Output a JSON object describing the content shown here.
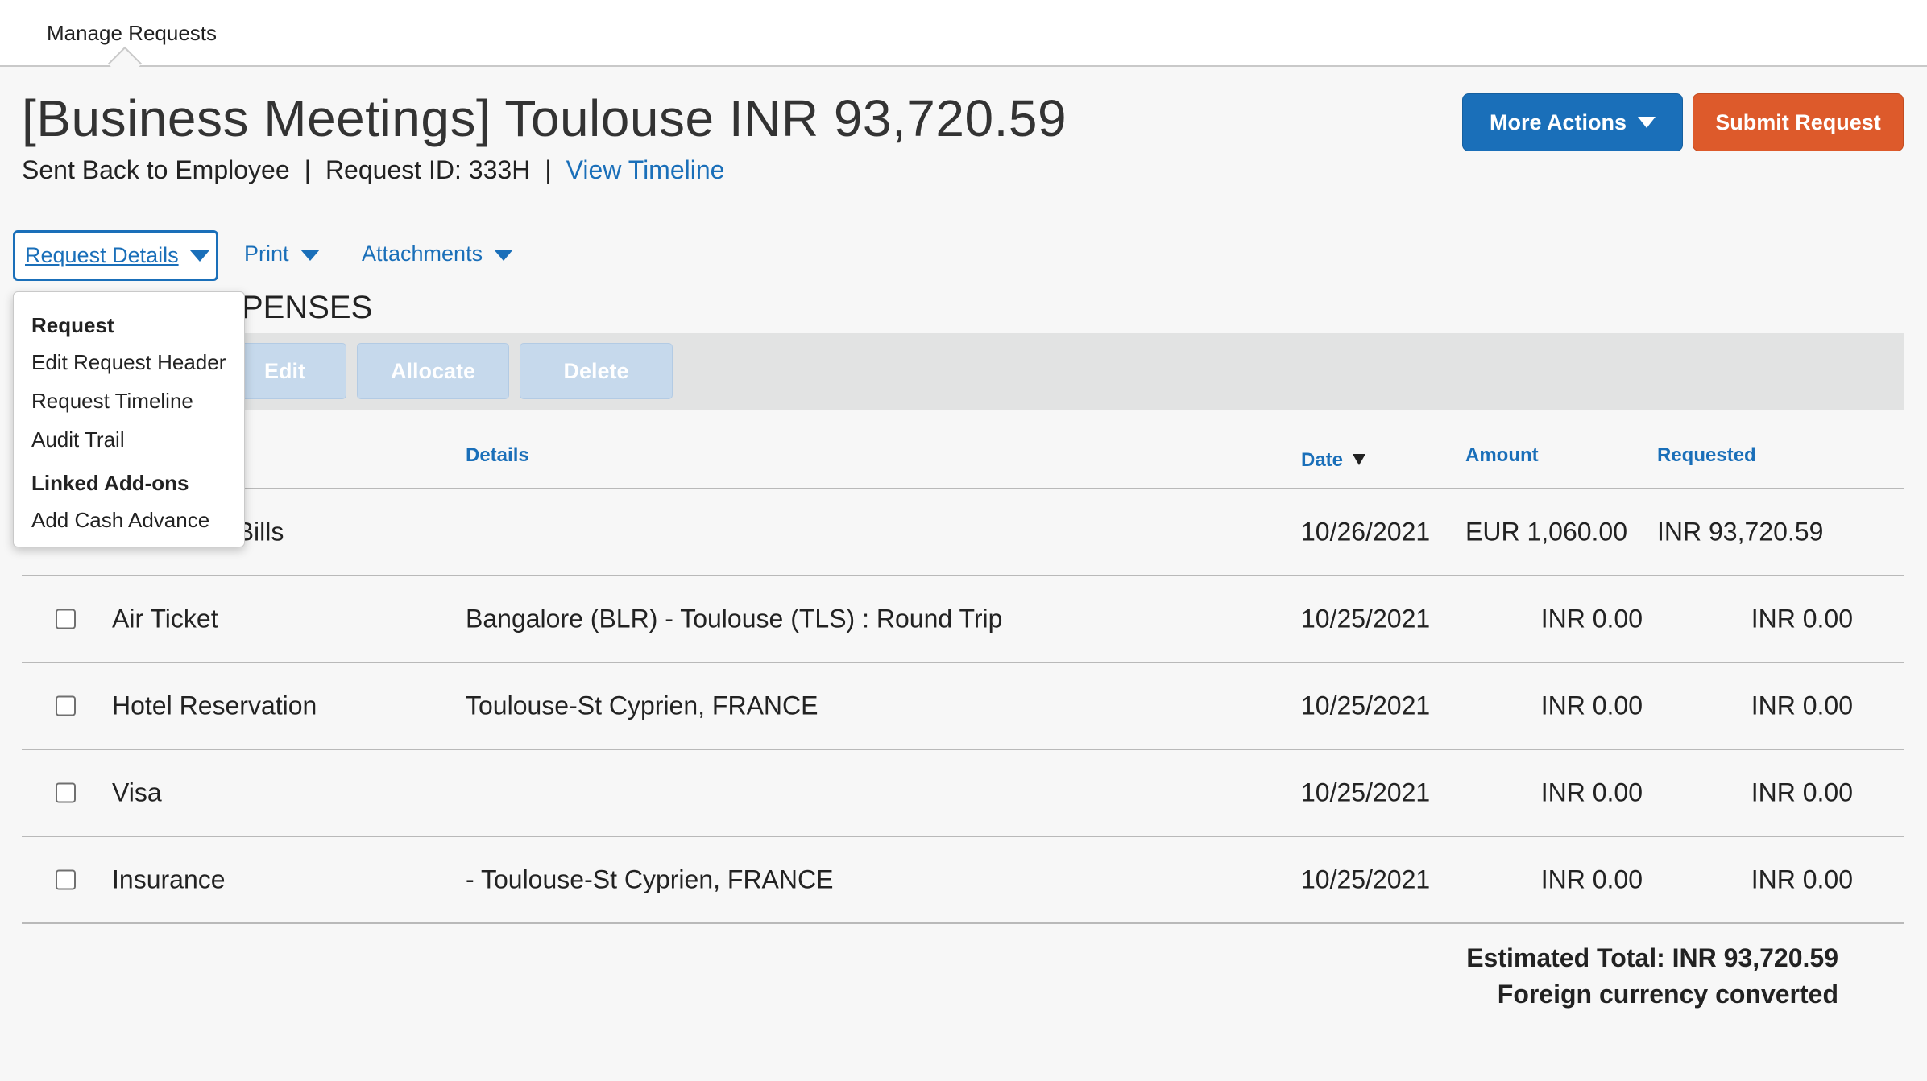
{
  "topbar": {
    "tab_label": "Manage Requests"
  },
  "header": {
    "title": "[Business Meetings] Toulouse INR 93,720.59",
    "status": "Sent Back to Employee",
    "request_id": "Request ID: 333H",
    "view_timeline": "View Timeline",
    "separator": "|"
  },
  "actions": {
    "more_actions": "More Actions",
    "submit_request": "Submit Request"
  },
  "subnav": {
    "request_details": "Request Details",
    "print": "Print",
    "attachments": "Attachments"
  },
  "section": {
    "title": "EXPENSES",
    "visible_title": "PENSES"
  },
  "toolbar": {
    "edit": "Edit",
    "allocate": "Allocate",
    "delete": "Delete"
  },
  "table": {
    "headers": {
      "details": "Details",
      "date": "Date",
      "amount": "Amount",
      "requested": "Requested"
    },
    "rows": [
      {
        "type": "n Bills",
        "details": "",
        "date": "10/26/2021",
        "amount": "EUR 1,060.00",
        "requested": "INR 93,720.59"
      },
      {
        "type": "Air Ticket",
        "details": "Bangalore (BLR) - Toulouse (TLS) : Round Trip",
        "date": "10/25/2021",
        "amount": "INR 0.00",
        "requested": "INR 0.00"
      },
      {
        "type": "Hotel Reservation",
        "details": "Toulouse-St Cyprien, FRANCE",
        "date": "10/25/2021",
        "amount": "INR 0.00",
        "requested": "INR 0.00"
      },
      {
        "type": "Visa",
        "details": "",
        "date": "10/25/2021",
        "amount": "INR 0.00",
        "requested": "INR 0.00"
      },
      {
        "type": "Insurance",
        "details": "- Toulouse-St Cyprien, FRANCE",
        "date": "10/25/2021",
        "amount": "INR 0.00",
        "requested": "INR 0.00"
      }
    ]
  },
  "totals": {
    "estimated_total": "Estimated Total: INR 93,720.59",
    "note": "Foreign currency converted"
  },
  "dropdown": {
    "request_header": "Request",
    "edit_request_header": "Edit Request Header",
    "request_timeline": "Request Timeline",
    "audit_trail": "Audit Trail",
    "linked_addons_header": "Linked Add-ons",
    "add_cash_advance": "Add Cash Advance"
  },
  "colors": {
    "primary": "#1a6fb9",
    "submit": "#dd5a2b",
    "disabled_button": "#c6d9ec"
  }
}
